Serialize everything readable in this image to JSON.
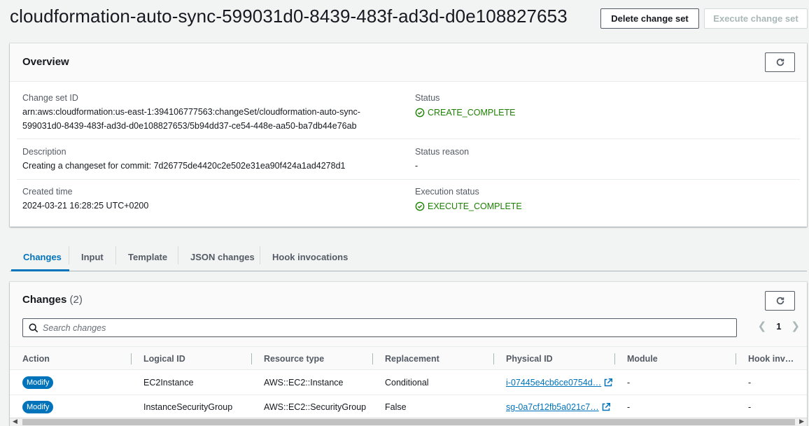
{
  "header": {
    "title": "cloudformation-auto-sync-599031d0-8439-483f-ad3d-d0e108827653",
    "delete_button": "Delete change set",
    "execute_button": "Execute change set"
  },
  "overview": {
    "title": "Overview",
    "change_set_id_label": "Change set ID",
    "change_set_id_line1": "arn:aws:cloudformation:us-east-1:394106777563:changeSet/cloudformation-auto-sync-",
    "change_set_id_line2": "599031d0-8439-483f-ad3d-d0e108827653/5b94dd37-ce54-448e-aa50-ba7db44e76ab",
    "status_label": "Status",
    "status_value": "CREATE_COMPLETE",
    "description_label": "Description",
    "description_value": "Creating a changeset for commit: 7d26775de4420c2e502e31ea90f424a1ad4278d1",
    "status_reason_label": "Status reason",
    "status_reason_value": "-",
    "created_time_label": "Created time",
    "created_time_value": "2024-03-21 16:28:25 UTC+0200",
    "execution_status_label": "Execution status",
    "execution_status_value": "EXECUTE_COMPLETE"
  },
  "tabs": [
    "Changes",
    "Input",
    "Template",
    "JSON changes",
    "Hook invocations"
  ],
  "changes": {
    "title": "Changes",
    "count": "(2)",
    "search_placeholder": "Search changes",
    "page": "1",
    "columns": [
      "Action",
      "Logical ID",
      "Resource type",
      "Replacement",
      "Physical ID",
      "Module",
      "Hook inv…"
    ],
    "rows": [
      {
        "action": "Modify",
        "logical_id": "EC2Instance",
        "resource_type": "AWS::EC2::Instance",
        "replacement": "Conditional",
        "physical_id": "i-07445e4cb6ce0754d…",
        "module": "-",
        "hook": "-"
      },
      {
        "action": "Modify",
        "logical_id": "InstanceSecurityGroup",
        "resource_type": "AWS::EC2::SecurityGroup",
        "replacement": "False",
        "physical_id": "sg-0a7cf12fb5a021c7…",
        "module": "-",
        "hook": "-"
      }
    ]
  },
  "colors": {
    "accent": "#0073bb",
    "success": "#1d8102",
    "text": "#16191f",
    "muted": "#545b64"
  }
}
